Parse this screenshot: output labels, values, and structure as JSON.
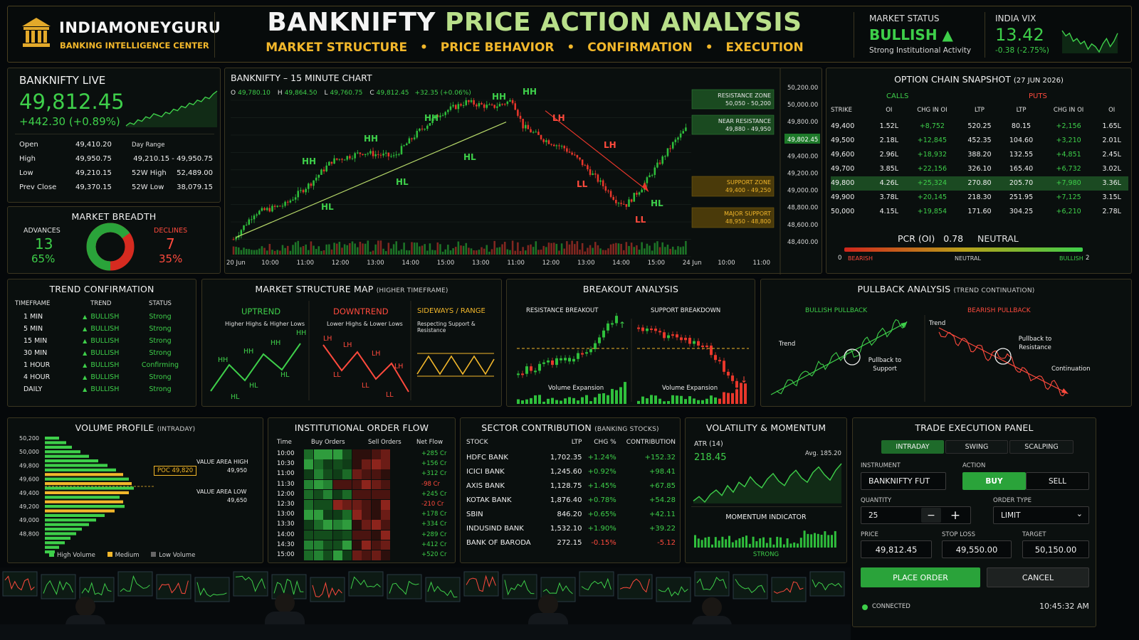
{
  "header": {
    "brand_name": "INDIAMONEYGURU",
    "brand_sub": "BANKING INTELLIGENCE CENTER",
    "title_main": "BANKNIFTY",
    "title_rest": "PRICE ACTION ANALYSIS",
    "subtitle_items": [
      "MARKET STRUCTURE",
      "PRICE BEHAVIOR",
      "CONFIRMATION",
      "EXECUTION"
    ],
    "market_status_label": "MARKET STATUS",
    "market_status_value": "BULLISH ▲",
    "market_status_note": "Strong Institutional Activity",
    "vix_label": "INDIA VIX",
    "vix_value": "13.42",
    "vix_change": "-0.38 (-2.75%)",
    "vix_spark": [
      14,
      13.8,
      13.9,
      13.6,
      13.7,
      13.5,
      13.6,
      13.3,
      13.5,
      13.4,
      13.2,
      13.5,
      13.7,
      13.4,
      13.6,
      13.9
    ]
  },
  "live": {
    "title": "BANKNIFTY LIVE",
    "price": "49,812.45",
    "change": "+442.30 (+0.89%)",
    "spark": [
      10,
      12,
      11,
      14,
      13,
      16,
      15,
      18,
      17,
      16,
      19,
      18,
      21,
      20,
      23,
      22,
      25,
      24,
      27,
      26,
      29,
      28,
      31,
      33
    ],
    "stats_left": [
      [
        "Open",
        "49,410.20"
      ],
      [
        "High",
        "49,950.75"
      ],
      [
        "Low",
        "49,210.15"
      ],
      [
        "Prev Close",
        "49,370.15"
      ]
    ],
    "stats_right_head": "Day Range",
    "stats_right": [
      [
        "",
        "49,210.15 - 49,950.75"
      ],
      [
        "52W High",
        "52,489.00"
      ],
      [
        "52W Low",
        "38,079.15"
      ]
    ]
  },
  "breadth": {
    "title": "MARKET BREADTH",
    "adv_label": "ADVANCES",
    "adv_value": "13",
    "adv_pct": "65%",
    "dec_label": "DECLINES",
    "dec_value": "7",
    "dec_pct": "35%",
    "adv_fraction": 0.65
  },
  "chart": {
    "title": "BANKNIFTY – 15 MINUTE CHART",
    "ohlc": [
      [
        "O",
        "49,780.10"
      ],
      [
        "H",
        "49,864.50"
      ],
      [
        "L",
        "49,760.75"
      ],
      [
        "C",
        "49,812.45"
      ],
      [
        "",
        "+32.35 (+0.06%)"
      ]
    ],
    "y_ticks": [
      "50,200.00",
      "50,000.00",
      "49,800.00",
      "49,600.00",
      "49,400.00",
      "49,200.00",
      "49,000.00",
      "48,800.00",
      "48,600.00",
      "48,400.00"
    ],
    "price_tag": "49,802.45",
    "x_ticks": [
      "20 Jun",
      "10:00",
      "11:00",
      "12:00",
      "13:00",
      "14:00",
      "15:00",
      "13:00",
      "11:00",
      "12:00",
      "13:00",
      "14:00",
      "15:00",
      "24 Jun",
      "10:00",
      "11:00"
    ],
    "zones": [
      {
        "label": "RESISTANCE ZONE",
        "range": "50,050 - 50,200",
        "kind": "res"
      },
      {
        "label": "NEAR RESISTANCE",
        "range": "49,880 - 49,950",
        "kind": "res"
      },
      {
        "label": "SUPPORT ZONE",
        "range": "49,400 - 49,250",
        "kind": "sup"
      },
      {
        "label": "MAJOR SUPPORT",
        "range": "48,950 - 48,800",
        "kind": "sup"
      }
    ],
    "swing_labels": [
      "HL",
      "HH",
      "HL",
      "HH",
      "HH",
      "HL",
      "HH",
      "HH",
      "HH",
      "LH",
      "LH",
      "LL",
      "LL",
      "HL"
    ]
  },
  "option_chain": {
    "title": "OPTION CHAIN SNAPSHOT",
    "date": "(27 JUN 2026)",
    "calls_label": "CALLS",
    "puts_label": "PUTS",
    "headers": [
      "STRIKE",
      "OI",
      "CHG IN OI",
      "LTP",
      "LTP",
      "CHG IN OI",
      "OI"
    ],
    "rows": [
      [
        "49,400",
        "1.52L",
        "+8,752",
        "520.25",
        "80.15",
        "+2,156",
        "1.65L"
      ],
      [
        "49,500",
        "2.18L",
        "+12,845",
        "452.35",
        "104.60",
        "+3,210",
        "2.01L"
      ],
      [
        "49,600",
        "2.96L",
        "+18,932",
        "388.20",
        "132.55",
        "+4,851",
        "2.45L"
      ],
      [
        "49,700",
        "3.85L",
        "+22,156",
        "326.10",
        "165.40",
        "+6,732",
        "3.02L"
      ],
      [
        "49,800",
        "4.26L",
        "+25,324",
        "270.80",
        "205.70",
        "+7,980",
        "3.36L"
      ],
      [
        "49,900",
        "3.78L",
        "+20,145",
        "218.30",
        "251.95",
        "+7,125",
        "3.15L"
      ],
      [
        "50,000",
        "4.15L",
        "+19,854",
        "171.60",
        "304.25",
        "+6,210",
        "2.78L"
      ]
    ],
    "highlight_row": 4,
    "pcr_label": "PCR (OI)",
    "pcr_value": "0.78",
    "pcr_state": "NEUTRAL",
    "scale": [
      "0",
      "BEARISH",
      "NEUTRAL",
      "BULLISH",
      "2"
    ]
  },
  "trend": {
    "title": "TREND CONFIRMATION",
    "headers": [
      "TIMEFRAME",
      "TREND",
      "STATUS"
    ],
    "rows": [
      [
        "1 MIN",
        "BULLISH",
        "Strong"
      ],
      [
        "5 MIN",
        "BULLISH",
        "Strong"
      ],
      [
        "15 MIN",
        "BULLISH",
        "Strong"
      ],
      [
        "30 MIN",
        "BULLISH",
        "Strong"
      ],
      [
        "1 HOUR",
        "BULLISH",
        "Confirming"
      ],
      [
        "4 HOUR",
        "BULLISH",
        "Strong"
      ],
      [
        "DAILY",
        "BULLISH",
        "Strong"
      ]
    ]
  },
  "structure": {
    "title": "MARKET STRUCTURE MAP",
    "title_small": "(HIGHER TIMEFRAME)",
    "up_title": "UPTREND",
    "up_sub": "Higher Highs & Higher Lows",
    "down_title": "DOWNTREND",
    "down_sub": "Lower Highs & Lower Lows",
    "side_title": "SIDEWAYS / RANGE",
    "side_sub": "Respecting Support & Resistance",
    "up_labels": [
      "HH",
      "HH",
      "HH",
      "HH",
      "HL",
      "HL",
      "HL"
    ],
    "down_labels": [
      "LH",
      "LH",
      "LH",
      "LH",
      "LL",
      "LL",
      "LL"
    ]
  },
  "breakout": {
    "title": "BREAKOUT ANALYSIS",
    "left_title": "RESISTANCE BREAKOUT",
    "right_title": "SUPPORT BREAKDOWN",
    "vol_label": "Volume Expansion"
  },
  "pullback": {
    "title": "PULLBACK ANALYSIS",
    "title_small": "(TREND CONTINUATION)",
    "bull_title": "BULLISH PULLBACK",
    "bear_title": "BEARISH PULLBACK",
    "trend": "Trend",
    "bull_note": "Pullback to Support",
    "bear_note": "Pullback to Resistance",
    "continuation": "Continuation"
  },
  "volume_profile": {
    "title": "VOLUME PROFILE",
    "title_small": "(INTRADAY)",
    "levels": [
      "50,200",
      "50,000",
      "49,800",
      "49,600",
      "49,400",
      "49,200",
      "49,000",
      "48,800"
    ],
    "poc": "POC 49,820",
    "vah_label": "VALUE AREA HIGH",
    "vah_value": "49,950",
    "val_label": "VALUE AREA LOW",
    "val_value": "49,650",
    "legend": [
      "High Volume",
      "Medium",
      "Low Volume"
    ]
  },
  "order_flow": {
    "title": "INSTITUTIONAL ORDER FLOW",
    "headers": [
      "Time",
      "Buy Orders",
      "Sell Orders",
      "Net Flow"
    ],
    "rows": [
      [
        "10:00",
        "+285 Cr"
      ],
      [
        "10:30",
        "+156 Cr"
      ],
      [
        "11:00",
        "+312 Cr"
      ],
      [
        "11:30",
        "-98 Cr"
      ],
      [
        "12:00",
        "+245 Cr"
      ],
      [
        "12:30",
        "-210 Cr"
      ],
      [
        "13:00",
        "+178 Cr"
      ],
      [
        "13:30",
        "+334 Cr"
      ],
      [
        "14:00",
        "+289 Cr"
      ],
      [
        "14:30",
        "+412 Cr"
      ],
      [
        "15:00",
        "+520 Cr"
      ]
    ]
  },
  "sector": {
    "title": "SECTOR CONTRIBUTION",
    "title_small": "(BANKING STOCKS)",
    "headers": [
      "STOCK",
      "LTP",
      "CHG %",
      "CONTRIBUTION"
    ],
    "rows": [
      [
        "HDFC BANK",
        "1,702.35",
        "+1.24%",
        "+152.32"
      ],
      [
        "ICICI BANK",
        "1,245.60",
        "+0.92%",
        "+98.41"
      ],
      [
        "AXIS BANK",
        "1,128.75",
        "+1.45%",
        "+67.85"
      ],
      [
        "KOTAK BANK",
        "1,876.40",
        "+0.78%",
        "+54.28"
      ],
      [
        "SBIN",
        "846.20",
        "+0.65%",
        "+42.11"
      ],
      [
        "INDUSIND BANK",
        "1,532.10",
        "+1.90%",
        "+39.22"
      ],
      [
        "BANK OF BARODA",
        "272.15",
        "-0.15%",
        "-5.12"
      ]
    ]
  },
  "volatility": {
    "title": "VOLATILITY & MOMENTUM",
    "atr_label": "ATR (14)",
    "atr_value": "218.45",
    "avg_label": "Avg. 185.20",
    "momentum_title": "MOMENTUM INDICATOR",
    "momentum_state": "STRONG",
    "atr_series": [
      30,
      34,
      29,
      36,
      40,
      35,
      44,
      38,
      47,
      43,
      52,
      46,
      42,
      50,
      55,
      48,
      44,
      53,
      58,
      51,
      47,
      56,
      61,
      54,
      49,
      58,
      64
    ]
  },
  "execution": {
    "title": "TRADE EXECUTION PANEL",
    "tabs": [
      "INTRADAY",
      "SWING",
      "SCALPING"
    ],
    "instrument_label": "INSTRUMENT",
    "instrument_value": "BANKNIFTY FUT",
    "action_label": "ACTION",
    "buy": "BUY",
    "sell": "SELL",
    "qty_label": "QUANTITY",
    "qty_value": "25",
    "minus": "−",
    "plus": "+",
    "order_type_label": "ORDER TYPE",
    "order_type_value": "LIMIT",
    "price_label": "PRICE",
    "price_value": "49,812.45",
    "sl_label": "STOP LOSS",
    "sl_value": "49,550.00",
    "target_label": "TARGET",
    "target_value": "50,150.00",
    "place": "PLACE ORDER",
    "cancel": "CANCEL",
    "status": "CONNECTED",
    "time": "10:45:32 AM"
  },
  "colors": {
    "green": "#3ecf4a",
    "red": "#ff4a3d",
    "gold": "#f2b72b",
    "panel": "#0a0f0e"
  }
}
